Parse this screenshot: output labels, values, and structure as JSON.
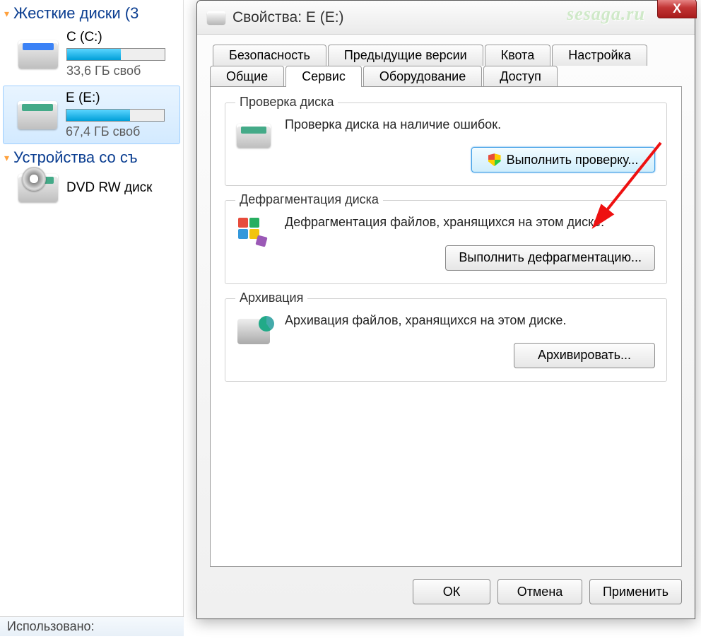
{
  "explorer": {
    "cat_drives": "Жесткие диски (3",
    "cat_removable": "Устройства со съ",
    "used_label": "Использовано:",
    "drives": [
      {
        "name": "C (C:)",
        "free": "33,6 ГБ своб"
      },
      {
        "name": "E (E:)",
        "free": "67,4 ГБ своб"
      }
    ],
    "dvd": "DVD RW диск"
  },
  "dialog": {
    "title": "Свойства: E (E:)",
    "watermark": "sesaga.ru",
    "tabs_row1": [
      "Безопасность",
      "Предыдущие версии",
      "Квота",
      "Настройка"
    ],
    "tabs_row2": [
      "Общие",
      "Сервис",
      "Оборудование",
      "Доступ"
    ],
    "active_tab": "Сервис",
    "groups": {
      "check": {
        "legend": "Проверка диска",
        "desc": "Проверка диска на наличие ошибок.",
        "button": "Выполнить проверку..."
      },
      "defrag": {
        "legend": "Дефрагментация диска",
        "desc": "Дефрагментация файлов, хранящихся на этом диске.",
        "button": "Выполнить дефрагментацию..."
      },
      "archive": {
        "legend": "Архивация",
        "desc": "Архивация файлов, хранящихся на этом диске.",
        "button": "Архивировать..."
      }
    },
    "buttons": {
      "ok": "ОК",
      "cancel": "Отмена",
      "apply": "Применить"
    }
  }
}
